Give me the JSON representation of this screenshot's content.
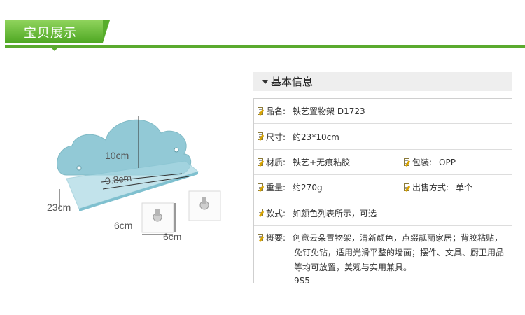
{
  "header": {
    "title": "宝贝展示"
  },
  "product_image": {
    "dimensions": {
      "height": "10cm",
      "depth": "9.8cm",
      "width": "23cm",
      "hook_height": "6cm",
      "hook_width": "6cm"
    },
    "colors": {
      "shelf": "#7fc0cf",
      "accent": "#5aaa2e"
    }
  },
  "info": {
    "section_title": "基本信息",
    "rows": [
      {
        "label": "品名:",
        "value": "铁艺置物架 D1723"
      },
      {
        "label": "尺寸:",
        "value": "约23*10cm"
      },
      {
        "label": "材质:",
        "value": "铁艺+无痕粘胶",
        "label2": "包装:",
        "value2": "OPP"
      },
      {
        "label": "重量:",
        "value": "约270g",
        "label2": "出售方式:",
        "value2": "单个"
      },
      {
        "label": "款式:",
        "value": "如颜色列表所示，可选"
      }
    ],
    "description": {
      "label": "概要:",
      "lines": [
        "创意云朵置物架，清新颜色，点缀靓丽家居；背胶粘贴，",
        "免钉免钻，适用光滑平整的墙面；摆件、文具、厨卫用品",
        "等均可放置，美观与实用兼具。"
      ],
      "code": "9S5"
    }
  }
}
